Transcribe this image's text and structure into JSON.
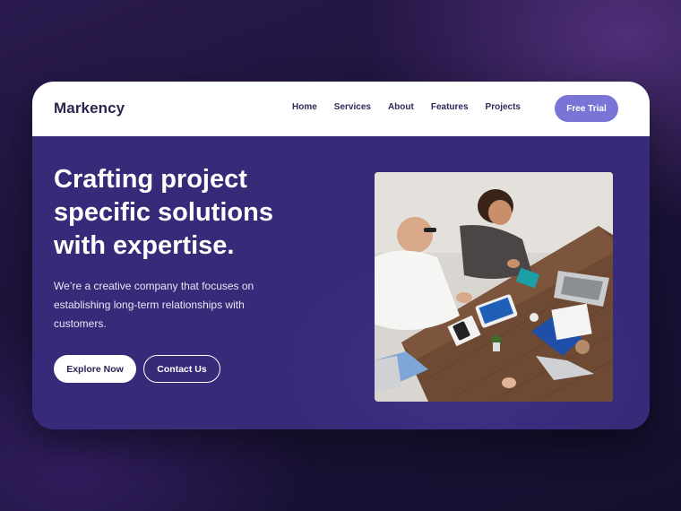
{
  "brand": {
    "name": "Markency"
  },
  "nav": {
    "links": [
      "Home",
      "Services",
      "About",
      "Features",
      "Projects"
    ],
    "cta_label": "Free Trial"
  },
  "hero": {
    "headline": "Crafting project specific solutions with expertise.",
    "description": "We’re a creative company that focuses on establishing long-term relationships with customers.",
    "primary_button": "Explore Now",
    "secondary_button": "Contact Us",
    "image_icon": "team-meeting-photo"
  },
  "colors": {
    "accent": "#7a74d6",
    "hero_background": "#372a78",
    "navbar_background": "#ffffff",
    "text_dark": "#2b2550"
  }
}
